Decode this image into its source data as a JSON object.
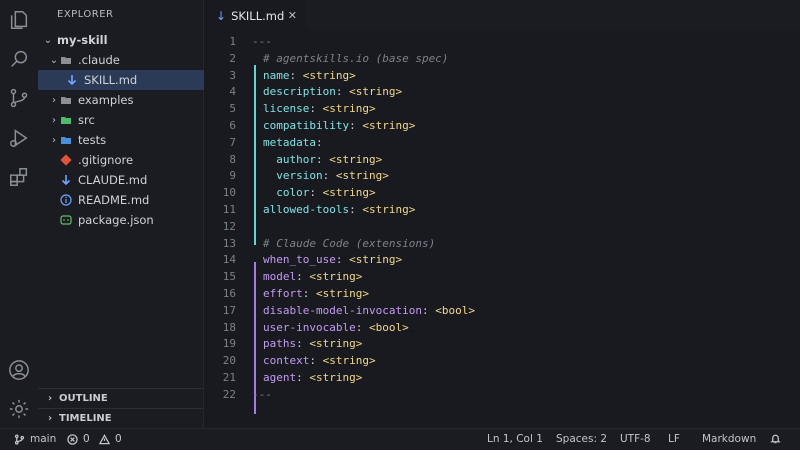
{
  "explorer": {
    "title": "EXPLORER",
    "root": "my-skill",
    "items": [
      {
        "label": ".claude",
        "icon": "folder-icon",
        "kind": "folder-open"
      },
      {
        "label": "SKILL.md",
        "icon": "markdown-arrow-icon",
        "kind": "file",
        "active": true
      },
      {
        "label": "examples",
        "icon": "folder-icon",
        "kind": "folder"
      },
      {
        "label": "src",
        "icon": "folder-green-icon",
        "kind": "folder"
      },
      {
        "label": "tests",
        "icon": "folder-blue-icon",
        "kind": "folder"
      },
      {
        "label": ".gitignore",
        "icon": "git-icon",
        "kind": "file"
      },
      {
        "label": "CLAUDE.md",
        "icon": "markdown-arrow-icon",
        "kind": "file"
      },
      {
        "label": "README.md",
        "icon": "info-icon",
        "kind": "file"
      },
      {
        "label": "package.json",
        "icon": "json-icon",
        "kind": "file"
      }
    ],
    "outline": "OUTLINE",
    "timeline": "TIMELINE"
  },
  "tab": {
    "label": "SKILL.md",
    "close": "✕"
  },
  "editor": {
    "lines": [
      {
        "n": "1",
        "type": "dash",
        "text": "---"
      },
      {
        "n": "2",
        "type": "comment",
        "text": "# agentskills.io (base spec)"
      },
      {
        "n": "3",
        "type": "kv",
        "key": "name",
        "value": "<string>",
        "group": "teal",
        "indent": ""
      },
      {
        "n": "4",
        "type": "kv",
        "key": "description",
        "value": "<string>",
        "group": "teal",
        "indent": ""
      },
      {
        "n": "5",
        "type": "kv",
        "key": "license",
        "value": "<string>",
        "group": "teal",
        "indent": ""
      },
      {
        "n": "6",
        "type": "kv",
        "key": "compatibility",
        "value": "<string>",
        "group": "teal",
        "indent": ""
      },
      {
        "n": "7",
        "type": "kv",
        "key": "metadata",
        "value": "",
        "group": "teal",
        "indent": ""
      },
      {
        "n": "8",
        "type": "kv",
        "key": "author",
        "value": "<string>",
        "group": "teal",
        "indent": "  "
      },
      {
        "n": "9",
        "type": "kv",
        "key": "version",
        "value": "<string>",
        "group": "teal",
        "indent": "  "
      },
      {
        "n": "10",
        "type": "kv",
        "key": "color",
        "value": "<string>",
        "group": "teal",
        "indent": "  "
      },
      {
        "n": "11",
        "type": "kv",
        "key": "allowed-tools",
        "value": "<string>",
        "group": "teal",
        "indent": ""
      },
      {
        "n": "12",
        "type": "blank",
        "text": ""
      },
      {
        "n": "13",
        "type": "comment",
        "text": "# Claude Code (extensions)"
      },
      {
        "n": "14",
        "type": "kv",
        "key": "when_to_use",
        "value": "<string>",
        "group": "purple",
        "indent": ""
      },
      {
        "n": "15",
        "type": "kv",
        "key": "model",
        "value": "<string>",
        "group": "purple",
        "indent": ""
      },
      {
        "n": "16",
        "type": "kv",
        "key": "effort",
        "value": "<string>",
        "group": "purple",
        "indent": ""
      },
      {
        "n": "17",
        "type": "kv",
        "key": "disable-model-invocation",
        "value": "<bool>",
        "group": "purple",
        "indent": ""
      },
      {
        "n": "18",
        "type": "kv",
        "key": "user-invocable",
        "value": "<bool>",
        "group": "purple",
        "indent": ""
      },
      {
        "n": "19",
        "type": "kv",
        "key": "paths",
        "value": "<string>",
        "group": "purple",
        "indent": ""
      },
      {
        "n": "20",
        "type": "kv",
        "key": "context",
        "value": "<string>",
        "group": "purple",
        "indent": ""
      },
      {
        "n": "21",
        "type": "kv",
        "key": "agent",
        "value": "<string>",
        "group": "purple",
        "indent": ""
      },
      {
        "n": "22",
        "type": "dash",
        "text": "---"
      }
    ]
  },
  "status": {
    "branch": "main",
    "errors": "0",
    "warnings": "0",
    "position": "Ln 1, Col 1",
    "spaces": "Spaces: 2",
    "encoding": "UTF-8",
    "eol": "LF",
    "language": "Markdown"
  },
  "colors": {
    "background": "#181a1f",
    "teal_key": "#7fe3e4",
    "purple_key": "#c49bf3",
    "value": "#f2d98a",
    "active_row": "#2a3a57"
  }
}
